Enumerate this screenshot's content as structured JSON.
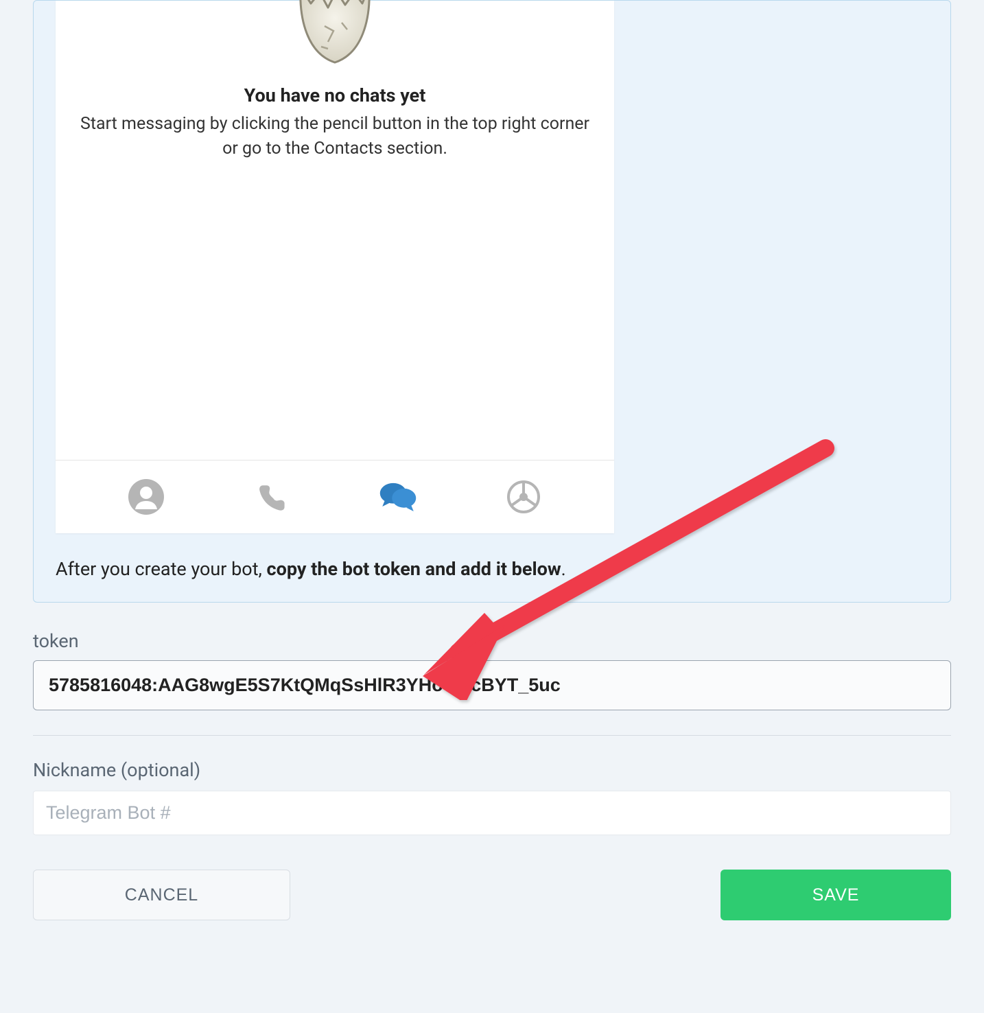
{
  "phone": {
    "no_chats_title": "You have no chats yet",
    "no_chats_sub": "Start messaging by clicking the pencil button in the top right corner or go to the Contacts section."
  },
  "instruction": {
    "prefix": "After you create your bot, ",
    "bold": "copy the bot token and add it below",
    "suffix": "."
  },
  "form": {
    "token_label": "token",
    "token_value": "5785816048:AAG8wgE5S7KtQMqSsHlR3YHoTjncBYT_5uc",
    "nickname_label": "Nickname (optional)",
    "nickname_placeholder": "Telegram Bot #",
    "cancel": "CANCEL",
    "save": "SAVE"
  }
}
